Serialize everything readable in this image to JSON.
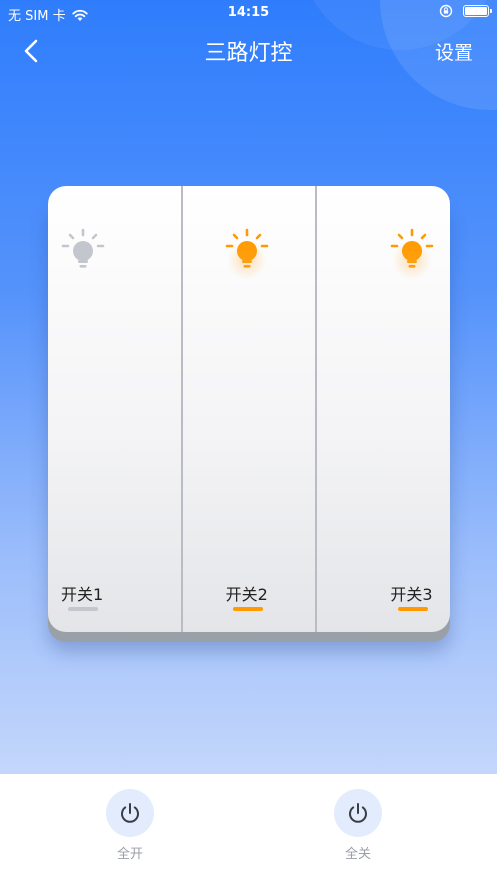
{
  "status_bar": {
    "carrier": "无 SIM 卡",
    "time": "14:15"
  },
  "nav": {
    "title": "三路灯控",
    "settings_label": "设置"
  },
  "switches": [
    {
      "label": "开关1",
      "state": "off",
      "color": "#c3c6cc"
    },
    {
      "label": "开关2",
      "state": "on",
      "color": "#ff9a00"
    },
    {
      "label": "开关3",
      "state": "on",
      "color": "#ff9a00"
    }
  ],
  "bottom_bar": {
    "all_on_label": "全开",
    "all_off_label": "全关"
  },
  "colors": {
    "accent": "#2f7dfc",
    "on": "#ff9a00",
    "off": "#c3c6cc",
    "power_icon": "#3a3d44"
  }
}
